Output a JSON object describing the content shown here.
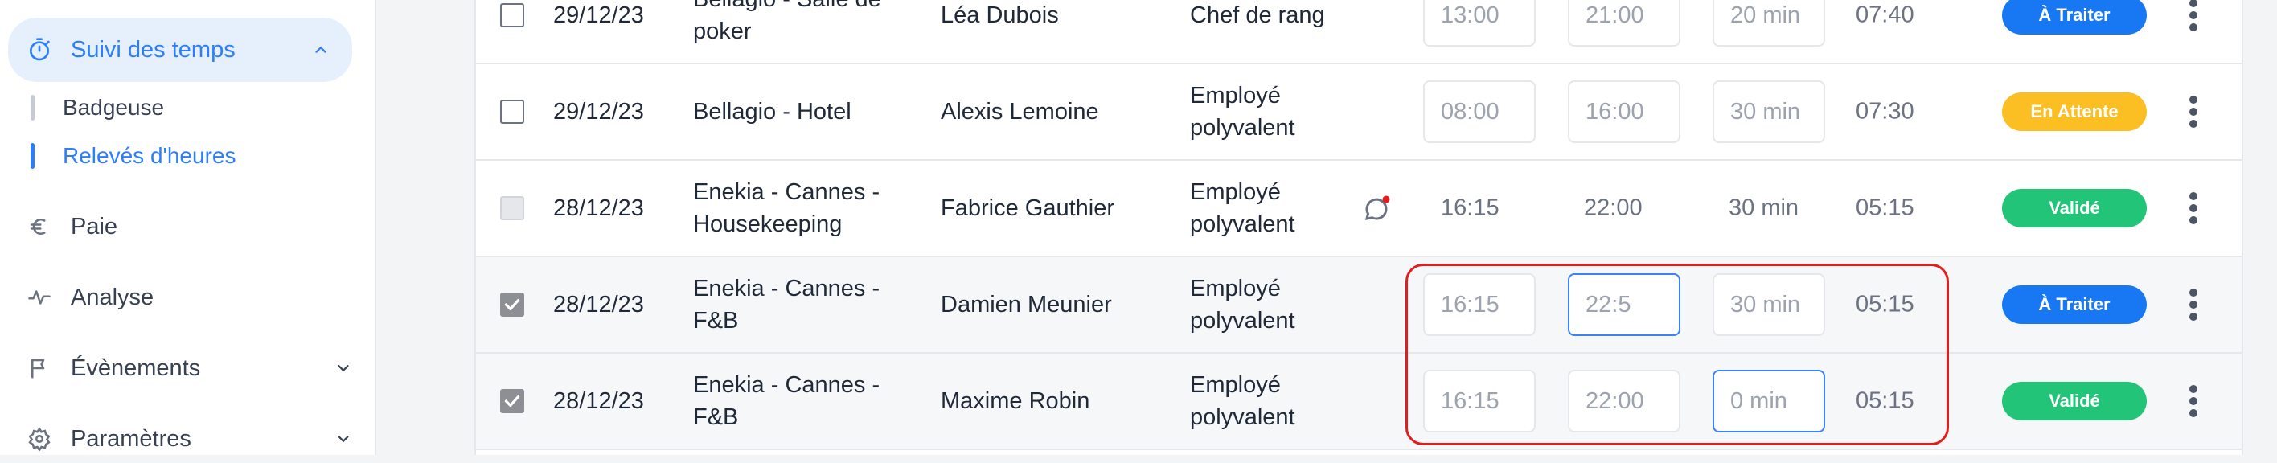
{
  "sidebar": {
    "active_section": {
      "label": "Suivi des temps",
      "icon": "stopwatch-icon"
    },
    "sub_items": [
      {
        "label": "Badgeuse",
        "active": false
      },
      {
        "label": "Relevés d'heures",
        "active": true
      }
    ],
    "items": [
      {
        "label": "Paie",
        "icon": "euro-icon"
      },
      {
        "label": "Analyse",
        "icon": "activity-icon"
      },
      {
        "label": "Évènements",
        "icon": "flag-icon"
      },
      {
        "label": "Paramètres",
        "icon": "gear-icon"
      }
    ]
  },
  "colors": {
    "accent": "#2d7ff9",
    "status_traiter": "#1877f2",
    "status_attente": "#fbbf24",
    "status_valide": "#22c578",
    "highlight": "#e11d1d"
  },
  "rows": [
    {
      "date": "29/12/23",
      "site": "Bellagio - Salle de poker",
      "name": "Léa Dubois",
      "role": "Chef de rang",
      "start": "13:00",
      "end": "21:00",
      "break": "20 min",
      "total": "07:40",
      "status": "À Traiter",
      "checkbox": "unchecked"
    },
    {
      "date": "29/12/23",
      "site": "Bellagio - Hotel",
      "name": "Alexis Lemoine",
      "role": "Employé polyvalent",
      "start": "08:00",
      "end": "16:00",
      "break": "30 min",
      "total": "07:30",
      "status": "En Attente",
      "checkbox": "unchecked"
    },
    {
      "date": "28/12/23",
      "site": "Enekia - Cannes - Housekeeping",
      "name": "Fabrice Gauthier",
      "role": "Employé polyvalent",
      "start": "16:15",
      "end": "22:00",
      "break": "30 min",
      "total": "05:15",
      "status": "Validé",
      "checkbox": "disabled"
    },
    {
      "date": "28/12/23",
      "site": "Enekia - Cannes - F&B",
      "name": "Damien Meunier",
      "role": "Employé polyvalent",
      "start": "16:15",
      "end": "22:5",
      "break": "30 min",
      "total": "05:15",
      "status": "À Traiter",
      "checkbox": "checked"
    },
    {
      "date": "28/12/23",
      "site": "Enekia - Cannes - F&B",
      "name": "Maxime Robin",
      "role": "Employé polyvalent",
      "start": "16:15",
      "end": "22:00",
      "break": "0 min",
      "total": "05:15",
      "status": "Validé",
      "checkbox": "checked"
    }
  ]
}
